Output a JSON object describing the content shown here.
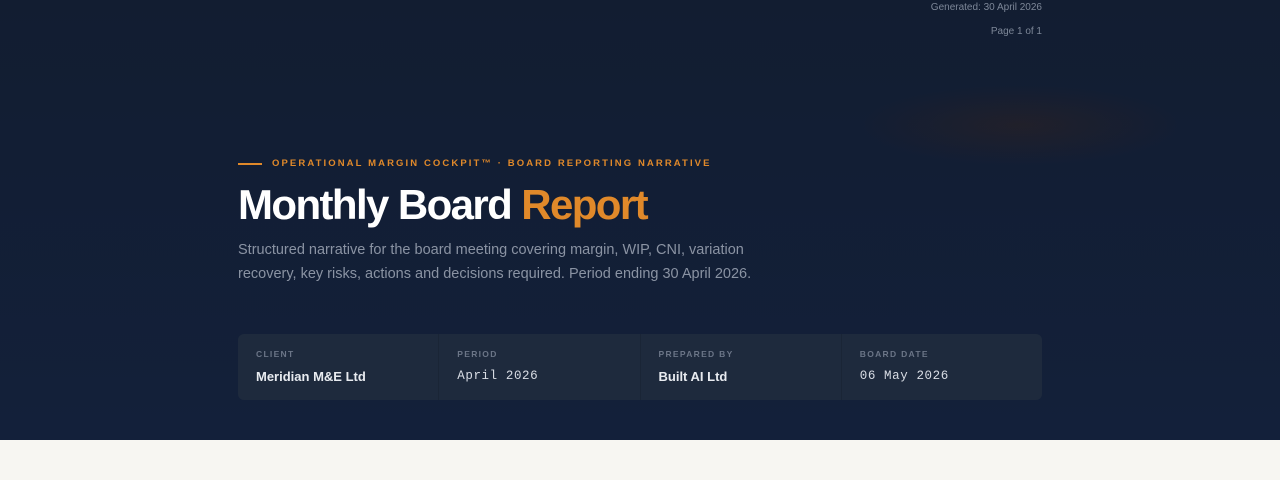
{
  "header_meta": {
    "generated": "Generated: 30 April 2026",
    "page": "Page 1 of 1"
  },
  "eyebrow": "OPERATIONAL MARGIN COCKPIT™ · BOARD REPORTING NARRATIVE",
  "title": {
    "main": "Monthly Board",
    "accent": "Report"
  },
  "description": "Structured narrative for the board meeting covering margin, WIP, CNI, variation recovery, key risks, actions and decisions required. Period ending 30 April 2026.",
  "info": [
    {
      "label": "CLIENT",
      "value": "Meridian M&E Ltd"
    },
    {
      "label": "PERIOD",
      "value": "April 2026"
    },
    {
      "label": "PREPARED BY",
      "value": "Built AI Ltd"
    },
    {
      "label": "BOARD DATE",
      "value": "06 May 2026"
    }
  ],
  "colors": {
    "accent": "#e0892a",
    "hero_background": "#13203a",
    "card_background": "#1e2a3d",
    "page_background": "#f7f6f2"
  }
}
